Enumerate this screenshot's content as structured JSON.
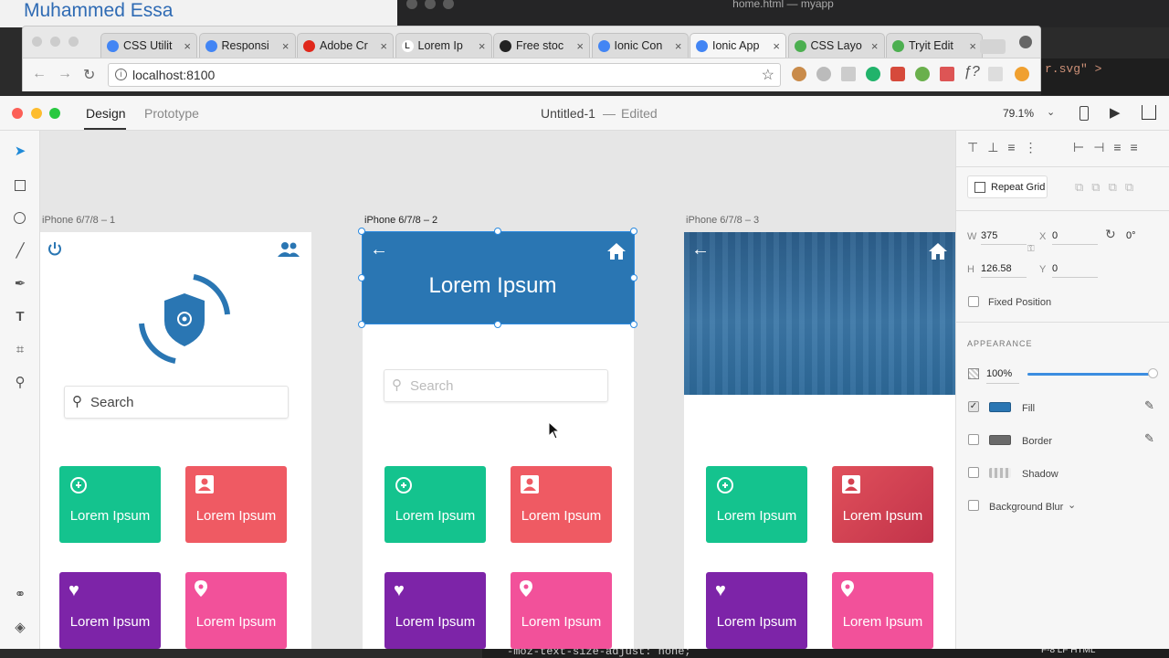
{
  "background": {
    "doc_title": "Muhammed Essa",
    "editor_title": "home.html — myapp",
    "editor_snippet": "r.svg\"  >",
    "code_bottom": "-moz-text-size-adjust: none;",
    "status_bottom": "F-8   LF   HTML"
  },
  "browser": {
    "tabs": [
      {
        "label": "CSS Utilit",
        "icon": "chrome-icon"
      },
      {
        "label": "Responsi",
        "icon": "chrome-icon"
      },
      {
        "label": "Adobe Cr",
        "icon": "adobe-icon"
      },
      {
        "label": "Lorem Ip",
        "icon": "lipsum-icon"
      },
      {
        "label": "Free stoc",
        "icon": "camera-icon"
      },
      {
        "label": "Ionic Con",
        "icon": "chrome-icon"
      },
      {
        "label": "Ionic App",
        "icon": "chrome-icon"
      },
      {
        "label": "CSS Layo",
        "icon": "w3-icon"
      },
      {
        "label": "Tryit Edit",
        "icon": "w3-icon"
      }
    ],
    "url": "localhost:8100"
  },
  "xd": {
    "tabs": {
      "design": "Design",
      "prototype": "Prototype"
    },
    "doc_title": "Untitled-1",
    "doc_sep": "—",
    "doc_status": "Edited",
    "zoom": "79.1%",
    "artboards": [
      {
        "label": "iPhone 6/7/8 – 1",
        "search": "Search"
      },
      {
        "label": "iPhone 6/7/8 – 2",
        "header": "Lorem Ipsum",
        "search": "Search"
      },
      {
        "label": "iPhone 6/7/8 – 3"
      }
    ],
    "card_label": "Lorem Ipsum",
    "colors": {
      "teal": "#14c38e",
      "coral": "#ef5a63",
      "purple": "#7d24a8",
      "pink": "#f2519a",
      "blue": "#2a76b3"
    },
    "panel": {
      "repeat_grid": "Repeat Grid",
      "w_label": "W",
      "w": "375",
      "h_label": "H",
      "h": "126.58",
      "x_label": "X",
      "x": "0",
      "y_label": "Y",
      "y": "0",
      "rotation": "0°",
      "fixed_position": "Fixed Position",
      "appearance": "APPEARANCE",
      "opacity": "100%",
      "fill": "Fill",
      "border": "Border",
      "shadow": "Shadow",
      "background_blur": "Background Blur"
    }
  }
}
